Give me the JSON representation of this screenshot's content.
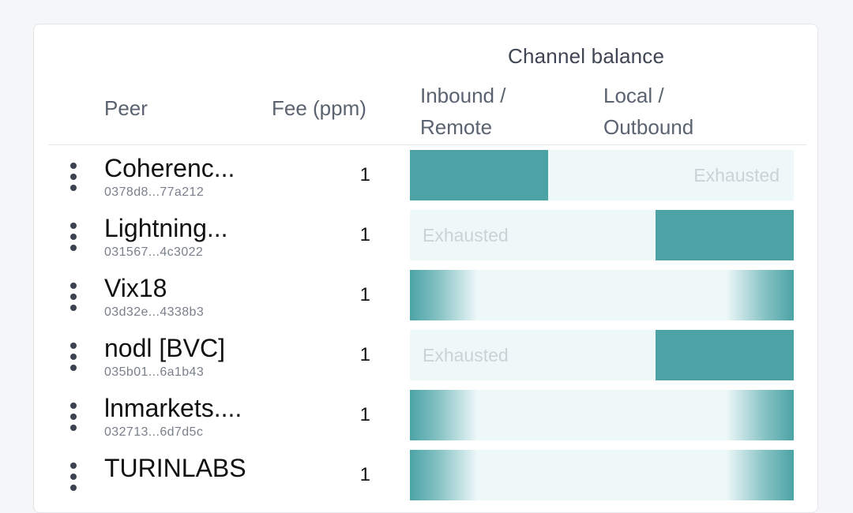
{
  "table": {
    "columns": {
      "peer": "Peer",
      "fee": "Fee (ppm)",
      "channel_balance": "Channel balance",
      "inbound_line1": "Inbound /",
      "inbound_line2": "Remote",
      "local_line1": "Local /",
      "local_line2": "Outbound"
    },
    "exhausted_label": "Exhausted",
    "colors": {
      "fill": "#4ba3a6",
      "track": "#eff8f9",
      "exhausted_text": "#c9d3d6"
    },
    "rows": [
      {
        "name": "Coherenc...",
        "key": "0378d8...77a212",
        "fee": "1",
        "inbound_fraction": 0.36,
        "outbound_fraction": 0.0,
        "exhausted_side": "right"
      },
      {
        "name": "Lightning...",
        "key": "031567...4c3022",
        "fee": "1",
        "inbound_fraction": 0.0,
        "outbound_fraction": 0.36,
        "exhausted_side": "left"
      },
      {
        "name": "Vix18",
        "key": "03d32e...4338b3",
        "fee": "1",
        "inbound_fraction": 0.5,
        "outbound_fraction": 0.5,
        "exhausted_side": "none"
      },
      {
        "name": "nodl [BVC]",
        "key": "035b01...6a1b43",
        "fee": "1",
        "inbound_fraction": 0.0,
        "outbound_fraction": 0.36,
        "exhausted_side": "left"
      },
      {
        "name": "lnmarkets....",
        "key": "032713...6d7d5c",
        "fee": "1",
        "inbound_fraction": 0.5,
        "outbound_fraction": 0.5,
        "exhausted_side": "none"
      },
      {
        "name": "TURINLABS",
        "key": "",
        "fee": "1",
        "inbound_fraction": 0.5,
        "outbound_fraction": 0.5,
        "exhausted_side": "none"
      }
    ]
  }
}
